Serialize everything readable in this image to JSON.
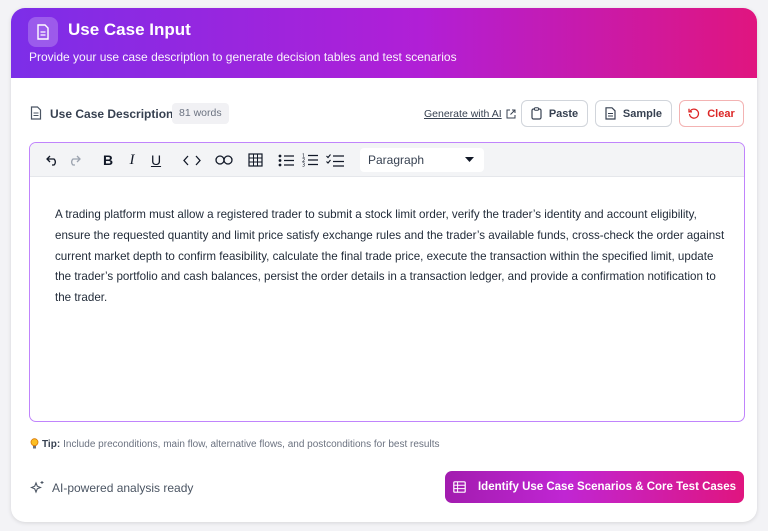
{
  "header": {
    "title": "Use Case Input",
    "subtitle": "Provide your use case description to generate decision tables and test scenarios",
    "icon": "document-icon"
  },
  "description": {
    "label": "Use Case Description",
    "word_count": "81 words",
    "generate_ai": "Generate with AI",
    "paste": "Paste",
    "sample": "Sample",
    "clear": "Clear"
  },
  "toolbar": {
    "paragraph": "Paragraph"
  },
  "editor": {
    "text": "A trading platform must allow a registered trader to submit a stock limit order, verify the trader’s identity and account eligibility, ensure the requested quantity and limit price satisfy exchange rules and the trader’s available funds, cross-check the order against current market depth to confirm feasibility, calculate the final trade price, execute the transaction within the specified limit, update the trader’s portfolio and cash balances, persist the order details in a transaction ledger, and provide a confirmation notification to the trader."
  },
  "tip": {
    "label": "Tip:",
    "text": "Include preconditions, main flow, alternative flows, and postconditions for best results"
  },
  "footer": {
    "status": "AI-powered analysis ready",
    "cta": "Identify Use Case Scenarios & Core Test Cases"
  },
  "colors": {
    "accent_purple": "#7c2ee8",
    "accent_pink": "#e0157f",
    "clear_red": "#dc2626",
    "editor_border": "#c084fc"
  }
}
